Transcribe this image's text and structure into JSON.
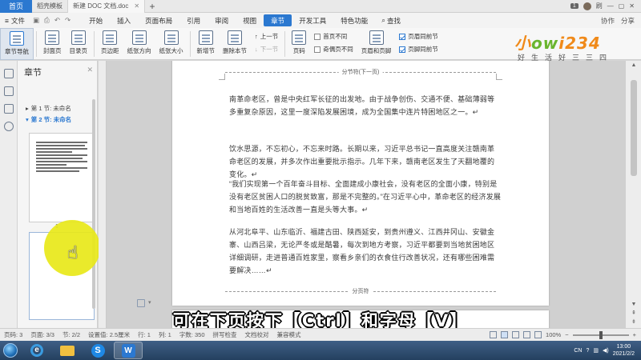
{
  "titlebar": {
    "home_tab": "首页",
    "tabs": [
      {
        "label": "稻壳模板",
        "active": false
      },
      {
        "label": "新建 DOC 文档.doc",
        "active": true
      }
    ],
    "badge": "1",
    "user": "刷"
  },
  "menubar": {
    "file": "文件",
    "items": [
      "开始",
      "插入",
      "页面布局",
      "引用",
      "审阅",
      "视图",
      "章节",
      "开发工具",
      "特色功能"
    ],
    "active": "章节",
    "search": "查找",
    "collab": "协作",
    "share": "分享"
  },
  "ribbon": {
    "buttons": [
      "章节导航",
      "封面页",
      "目录页",
      "页边距",
      "纸张方向",
      "纸张大小",
      "新增节",
      "删除本节"
    ],
    "prev_section": "上一节",
    "next_section": "下一节",
    "page_number": "页码",
    "checks_left": [
      {
        "label": "首页不同",
        "checked": false
      },
      {
        "label": "奇偶页不同",
        "checked": false
      }
    ],
    "header_footer": "页眉和页脚",
    "checks_right": [
      {
        "label": "页眉同前节",
        "checked": true
      },
      {
        "label": "页脚同前节",
        "checked": true
      }
    ]
  },
  "logo": {
    "main_a": "小",
    "main_b": "ow",
    "main_c": "i234",
    "sub": "好生活好三三四"
  },
  "navpane": {
    "title": "章节",
    "sections": [
      {
        "label": "第 1 节: 未命名"
      },
      {
        "label": "第 2 节: 未命名"
      }
    ],
    "thumb_page": "1"
  },
  "document": {
    "break_top": "分节符(下一页)",
    "break_bottom": "分页符",
    "paragraphs": [
      "南革命老区，曾是中央红军长征的出发地。由于战争创伤、交通不便、基础薄弱等多重复杂原因，这里一度深陷发展困境，成为全国集中连片特困地区之一。↵",
      "饮水思源，不忘初心，不忘来时路。长期以来，习近平总书记一直高度关注赣南革命老区的发展，并多次作出重要批示指示。几年下来，赣南老区发生了天翻地覆的变化。↵",
      "“我们实现第一个百年奋斗目标、全面建成小康社会，没有老区的全面小康，特别是没有老区贫困人口的脱贫致富，那是不完整的。”在习近平心中，革命老区的经济发展和当地百姓的生活改善一直是头等大事。↵",
      "从河北阜平、山东临沂、福建古田、陕西延安，到贵州遵义、江西井冈山、安徽金寨、山西吕梁，无论严冬或是酷暑，每次到地方考察，习近平都要到当地贫困地区详细调研，走进普通百姓家里，察看乡亲们的衣食住行改善状况，还有哪些困难需要解决……↵"
    ]
  },
  "subtitle": "可在下页按下【Ctrl】和字母【V】",
  "statusbar": {
    "page_num": "页码: 3",
    "page": "页面: 3/3",
    "section": "节: 2/2",
    "setting": "设置值: 2.5厘米",
    "row": "行: 1",
    "col": "列: 1",
    "words": "字数: 350",
    "spell": "拼写检查",
    "proof": "文档校对",
    "compat": "兼容模式",
    "zoom": "100%"
  },
  "taskbar": {
    "lang": "CN",
    "time": "13:00",
    "date": "2021/2/2"
  },
  "colors": {
    "accent": "#2b78d0",
    "highlight": "#e8e819",
    "logo_orange": "#f08a1a",
    "logo_green": "#6ab52e"
  }
}
